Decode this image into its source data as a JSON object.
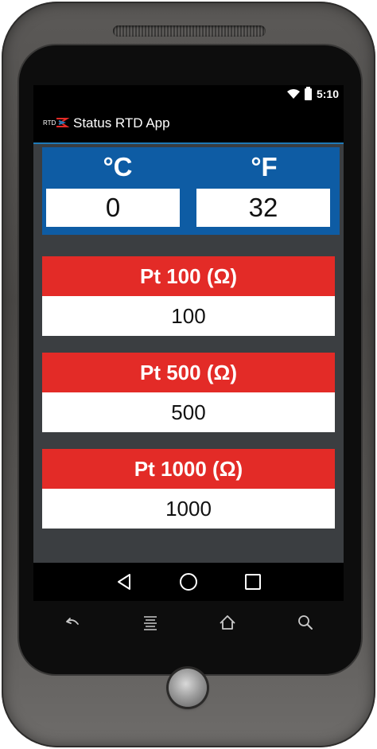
{
  "status_bar": {
    "time": "5:10",
    "wifi_icon": "wifi-icon",
    "battery_icon": "battery-icon"
  },
  "action_bar": {
    "logo_text": "RTD",
    "title": "Status RTD App"
  },
  "temperature": {
    "celsius_label": "°C",
    "celsius_value": "0",
    "fahrenheit_label": "°F",
    "fahrenheit_value": "32"
  },
  "resistances": [
    {
      "label": "Pt 100 (Ω)",
      "value": "100"
    },
    {
      "label": "Pt 500 (Ω)",
      "value": "500"
    },
    {
      "label": "Pt 1000 (Ω)",
      "value": "1000"
    }
  ],
  "nav_bar": {
    "back_icon": "back-triangle-icon",
    "home_icon": "home-circle-icon",
    "recents_icon": "recents-square-icon"
  },
  "hardware_keys": {
    "back": "back-arrow-icon",
    "menu": "menu-icon",
    "home": "home-icon",
    "search": "search-icon"
  },
  "colors": {
    "temp_panel": "#0e5ca4",
    "resistance_header": "#e32b27",
    "screen_background": "#3b3e41",
    "action_bar_accent": "#1e7ab8"
  }
}
